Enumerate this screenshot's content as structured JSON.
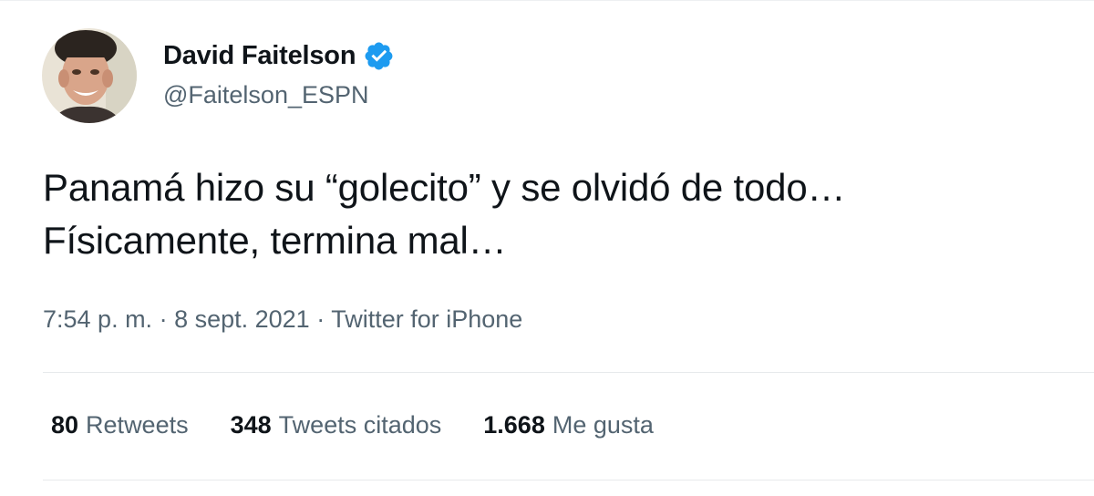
{
  "author": {
    "display_name": "David Faitelson",
    "handle": "@Faitelson_ESPN",
    "verified_icon": "verified-badge-icon",
    "badge_color": "#1d9bf0"
  },
  "tweet": {
    "lines": [
      "Panamá hizo su “golecito” y se olvidó de todo…",
      "Físicamente, termina mal…"
    ]
  },
  "meta": {
    "time": "7:54 p. m.",
    "separator": " · ",
    "date": "8 sept. 2021",
    "source": "Twitter for iPhone"
  },
  "stats": [
    {
      "count": "80",
      "label": "Retweets"
    },
    {
      "count": "348",
      "label": "Tweets citados"
    },
    {
      "count": "1.668",
      "label": "Me gusta"
    }
  ]
}
